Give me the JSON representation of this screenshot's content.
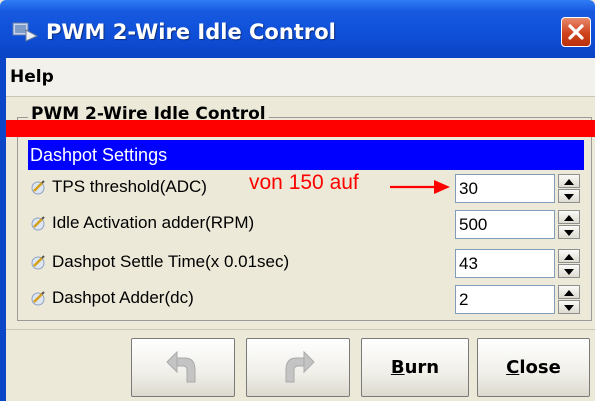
{
  "window": {
    "title": "PWM 2-Wire Idle Control",
    "close_icon": "close-x-icon"
  },
  "menubar": {
    "items": [
      "Help"
    ]
  },
  "group": {
    "title": "PWM 2-Wire Idle Control"
  },
  "section": {
    "header": "Dashpot Settings"
  },
  "rows": [
    {
      "label": "TPS threshold(ADC)",
      "value": "30",
      "annotation": "von 150 auf"
    },
    {
      "label": "Idle Activation adder(RPM)",
      "value": "500"
    },
    {
      "label": "Dashpot Settle Time(x 0.01sec)",
      "value": "43"
    },
    {
      "label": "Dashpot Adder(dc)",
      "value": "2"
    }
  ],
  "buttons": {
    "undo_icon": "undo-arrow-icon",
    "redo_icon": "redo-arrow-icon",
    "burn": {
      "mnemonic": "B",
      "rest": "urn"
    },
    "close": {
      "mnemonic": "C",
      "rest": "lose"
    }
  },
  "colors": {
    "title_bar": "#0a43c4",
    "section_header": "#0000ff",
    "annotation": "#ff0000",
    "highlight_bar": "#ff0000"
  }
}
